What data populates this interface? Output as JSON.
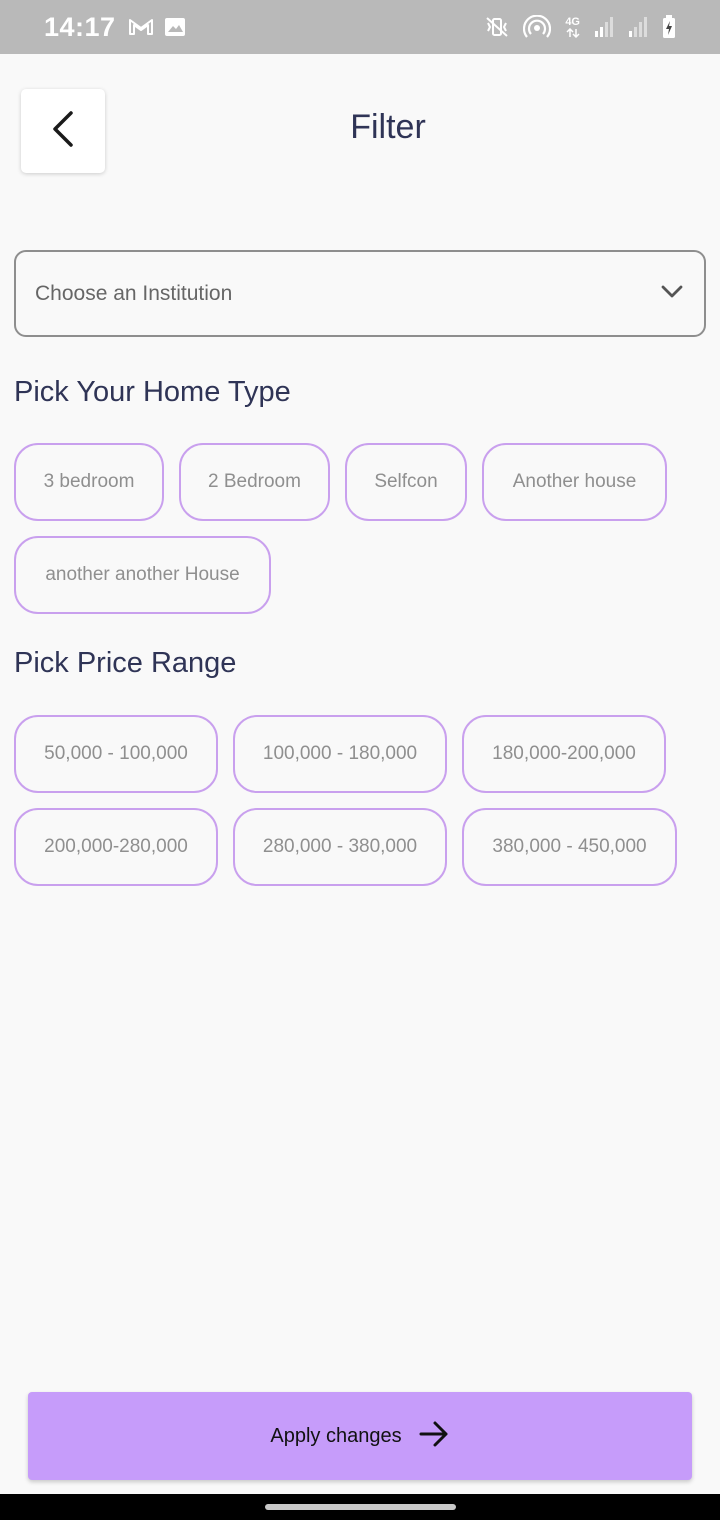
{
  "status_bar": {
    "time": "14:17",
    "left_icons": [
      "gmail-icon",
      "image-icon"
    ],
    "right_icons": [
      "mute-vibrate-icon",
      "hotspot-icon",
      "4g-data-icon",
      "signal-icon",
      "signal-icon",
      "battery-charging-icon"
    ],
    "network_label": "4G"
  },
  "header": {
    "title": "Filter",
    "back_icon": "chevron-left-icon"
  },
  "institution_select": {
    "placeholder": "Choose an Institution",
    "icon": "chevron-down-icon"
  },
  "home_type": {
    "title": "Pick Your Home Type",
    "options": [
      "3 bedroom",
      "2 Bedroom",
      "Selfcon",
      "Another house",
      "another another House"
    ]
  },
  "price_range": {
    "title": "Pick Price Range",
    "options": [
      "50,000 - 100,000",
      "100,000 - 180,000",
      "180,000-200,000",
      "200,000-280,000",
      "280,000 - 380,000",
      "380,000 - 450,000"
    ]
  },
  "apply": {
    "label": "Apply changes",
    "icon": "arrow-right-icon"
  },
  "colors": {
    "accent": "#c69cfa",
    "chip_border": "#c9a0ee",
    "title_text": "#2f3456",
    "status_bar": "#b9b9b9"
  }
}
